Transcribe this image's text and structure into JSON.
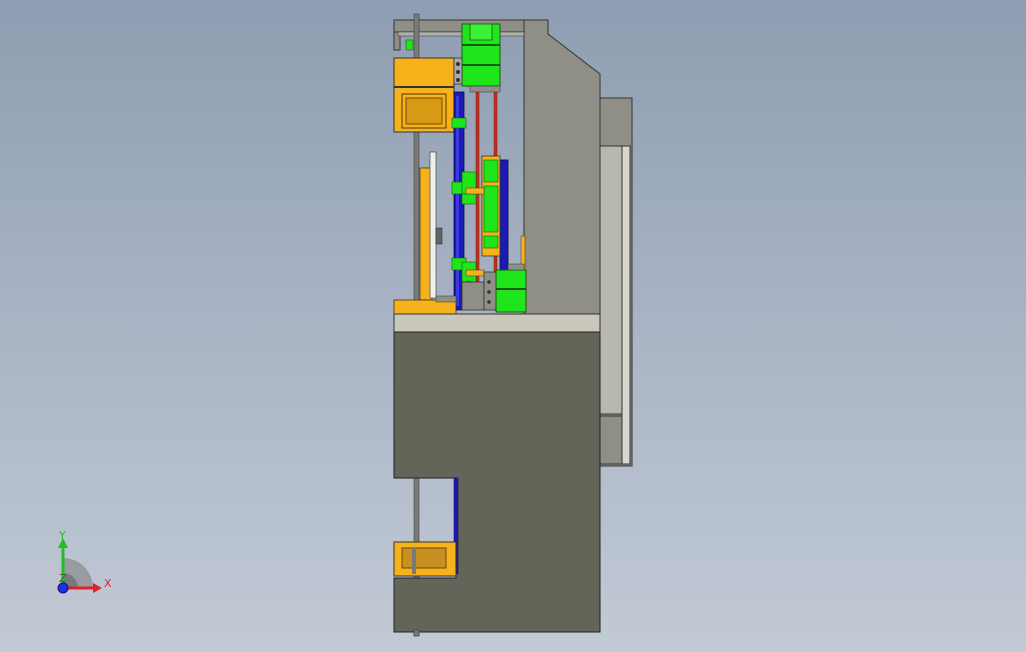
{
  "viewport": {
    "background_top": "#8e9db1",
    "background_bottom": "#c2cad5"
  },
  "model": {
    "colors": {
      "base": "#646559",
      "plate": "#c9c8bb",
      "frame": "#8f8f88",
      "yellow": "#f7b21b",
      "green": "#1ee61b",
      "blue": "#1b1bb4",
      "red": "#c03020",
      "rod": "#7a7a7a"
    }
  },
  "triad": {
    "x_label": "X",
    "y_label": "Y",
    "z_label": "Z",
    "x_color": "#e0202a",
    "y_color": "#20c020",
    "z_color": "#2030e0"
  }
}
